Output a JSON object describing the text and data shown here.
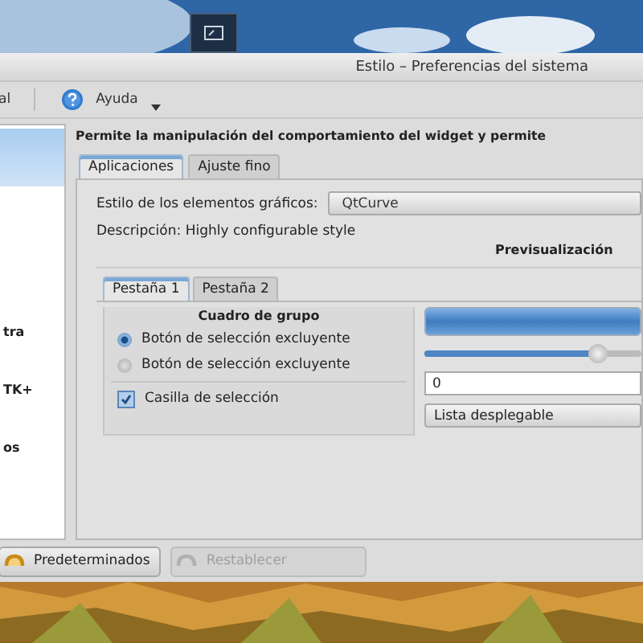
{
  "window": {
    "title": "Estilo – Preferencias del sistema"
  },
  "toolbar": [
    {
      "label": "al",
      "kind": "text"
    },
    {
      "label": "Ayuda",
      "kind": "help"
    }
  ],
  "sidebar": {
    "items": [
      {
        "selected": true
      },
      {
        "label": "tra",
        "selected": false
      },
      {
        "label": "TK+",
        "selected": false
      },
      {
        "label": "os",
        "selected": false
      }
    ]
  },
  "header": "Permite la manipulación del comportamiento del widget y permite",
  "tabs": [
    {
      "label": "Aplicaciones",
      "selected": true
    },
    {
      "label": "Ajuste fino",
      "selected": false
    }
  ],
  "style_field": {
    "label": "Estilo de los elementos gráficos:",
    "value": "QtCurve"
  },
  "description": "Descripción: Highly configurable style",
  "preview": {
    "title": "Previsualización",
    "tabs": [
      {
        "label": "Pestaña 1",
        "selected": true
      },
      {
        "label": "Pestaña 2",
        "selected": false
      }
    ],
    "group": {
      "title": "Cuadro de grupo",
      "radios": [
        {
          "label": "Botón de selección excluyente",
          "selected": true
        },
        {
          "label": "Botón de selección excluyente",
          "selected": false
        }
      ],
      "checkbox": {
        "label": "Casilla de selección",
        "checked": true
      }
    },
    "progress": {
      "level": 1
    },
    "slider": {
      "level": 0.8
    },
    "spinbox": {
      "value": "0"
    },
    "combo": {
      "value": "Lista desplegable"
    }
  },
  "buttons": [
    {
      "label": "Predeterminados",
      "disabled": false
    },
    {
      "label": "Restablecer",
      "disabled": true
    }
  ]
}
